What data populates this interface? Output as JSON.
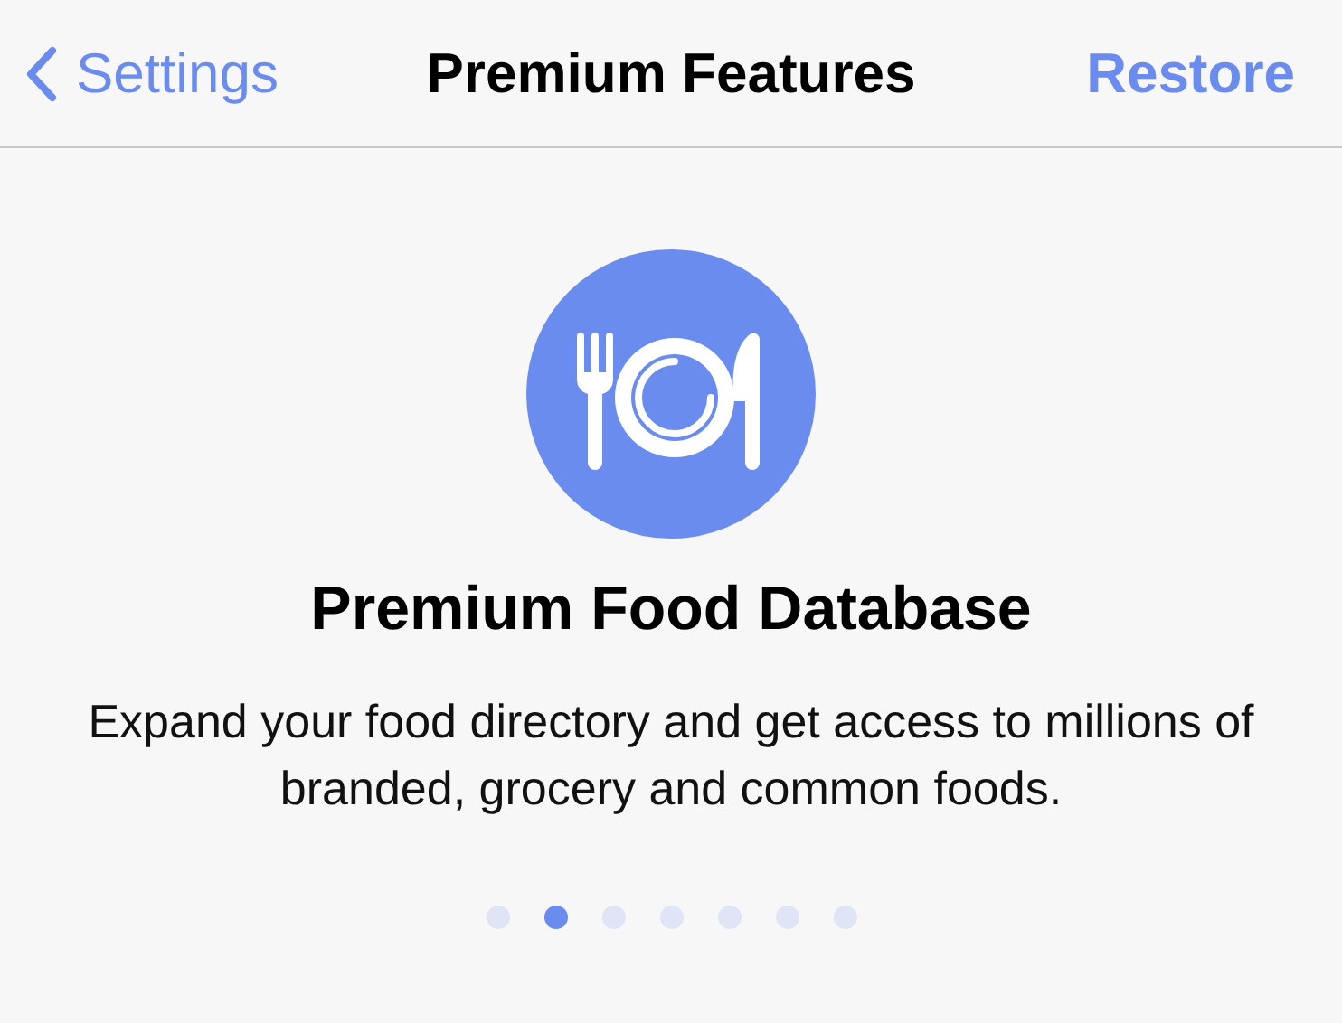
{
  "nav_bar": {
    "back_label": "Settings",
    "title": "Premium Features",
    "action": "Restore"
  },
  "feature": {
    "title": "Premium Food Database",
    "description": "Expand your food directory and get access to millions of branded, grocery and common foods."
  },
  "page_dots": [
    {
      "selected": false
    },
    {
      "selected": true
    },
    {
      "selected": false
    },
    {
      "selected": false
    },
    {
      "selected": false
    },
    {
      "selected": false
    },
    {
      "selected": false
    }
  ]
}
